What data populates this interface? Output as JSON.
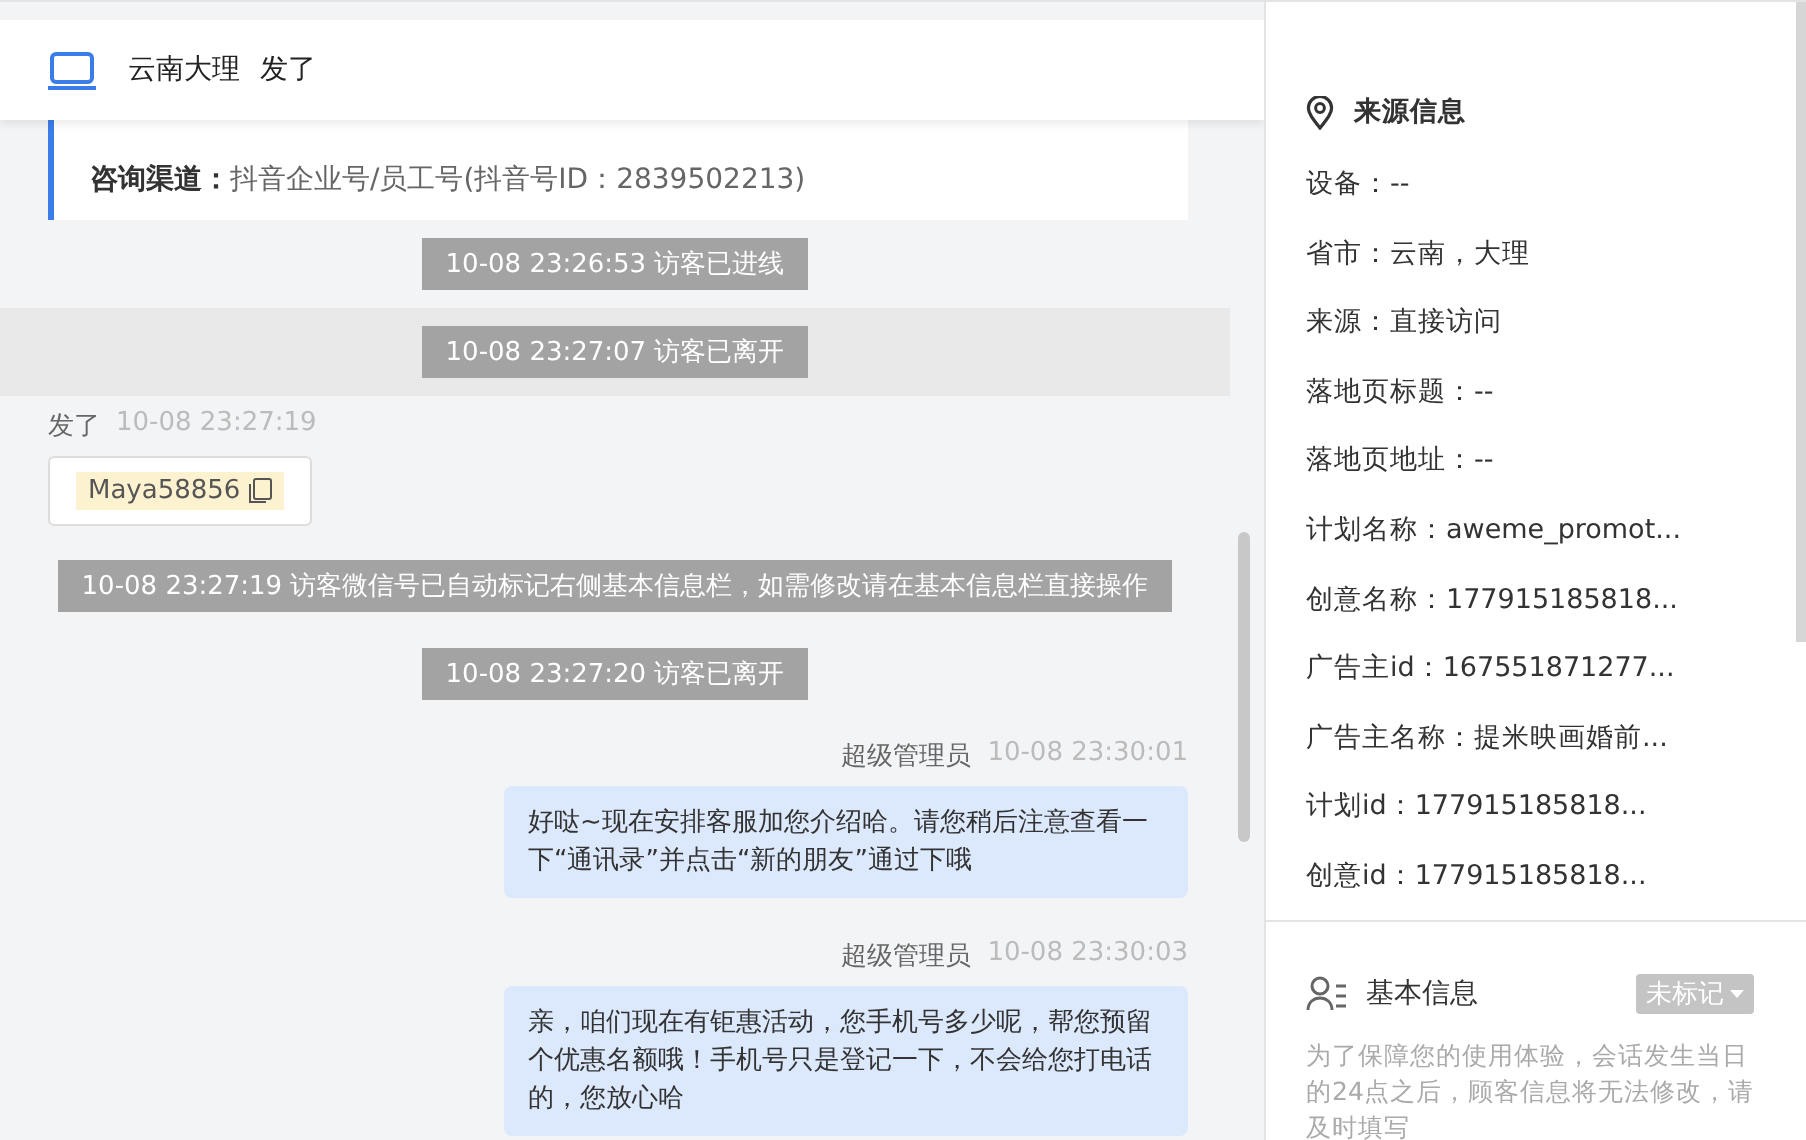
{
  "header": {
    "title_parts": [
      "云南大理",
      "发了"
    ]
  },
  "info_card": {
    "rows": [
      {
        "label": "咨询渠道：",
        "value": "抖音企业号/员工号(抖音号ID：2839502213)"
      }
    ]
  },
  "messages": [
    {
      "kind": "system",
      "text": "10-08 23:26:53 访客已进线",
      "highlighted": false
    },
    {
      "kind": "system",
      "text": "10-08 23:27:07 访客已离开",
      "highlighted": true
    },
    {
      "kind": "visitor",
      "name": "发了",
      "time": "10-08 23:27:19",
      "copy_text": "Maya58856"
    },
    {
      "kind": "system",
      "text": "10-08 23:27:19 访客微信号已自动标记右侧基本信息栏，如需修改请在基本信息栏直接操作",
      "highlighted": false
    },
    {
      "kind": "system",
      "text": "10-08 23:27:20 访客已离开",
      "highlighted": false
    },
    {
      "kind": "agent",
      "name": "超级管理员",
      "time": "10-08 23:30:01",
      "text": "好哒~现在安排客服加您介绍哈。请您稍后注意查看一下“通讯录”并点击“新的朋友”通过下哦"
    },
    {
      "kind": "agent",
      "name": "超级管理员",
      "time": "10-08 23:30:03",
      "text": "亲，咱们现在有钜惠活动，您手机号多少呢，帮您预留个优惠名额哦！手机号只是登记一下，不会给您打电话的，您放心哈"
    }
  ],
  "source_info": {
    "title": "来源信息",
    "fields": [
      "设备：--",
      "省市：云南，大理",
      "来源：直接访问",
      "落地页标题：--",
      "落地页地址：--",
      "计划名称：aweme_promot...",
      "创意名称：177915185818...",
      "广告主id：167551871277...",
      "广告主名称：提米映画婚前...",
      "计划id：177915185818...",
      "创意id：177915185818..."
    ]
  },
  "basic_info": {
    "title": "基本信息",
    "tag": "未标记",
    "notice": "为了保障您的使用体验，会话发生当日的24点之后，顾客信息将无法修改，请及时填写"
  }
}
